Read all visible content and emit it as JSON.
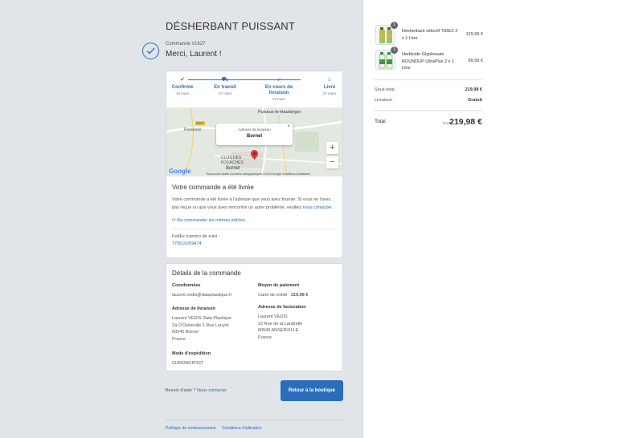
{
  "shop": {
    "title": "DÉSHERBANT PUISSANT"
  },
  "order": {
    "number": "Commande #1627",
    "thanks": "Merci, Laurent !"
  },
  "tracking": {
    "steps": [
      {
        "label": "Confirmé",
        "date": "19 mars",
        "icon": "check-icon"
      },
      {
        "label": "En transit",
        "date": "27 mars",
        "icon": "truck-icon"
      },
      {
        "label": "En cours de livraison",
        "date": "27 mars",
        "icon": "runner-icon"
      },
      {
        "label": "Livré",
        "date": "27 mars",
        "icon": "home-icon"
      }
    ]
  },
  "map": {
    "place1": "Puiseux-le-Hauberger",
    "place2": "Fosseuse",
    "place3": "CLOS DES FOUACHES",
    "place4": "Bornel",
    "road": "D927",
    "popup_title": "Adresse de livraison",
    "popup_value": "Bornel",
    "zoom_in": "+",
    "zoom_out": "−",
    "google": "Google",
    "attribution": "Raccourcis clavier   Données cartographiques ©2024 Google   Conditions d'utilisation"
  },
  "delivered": {
    "title": "Votre commande a été livrée",
    "text": "Votre commande a été livrée à l'adresse que vous avez fournie. Si vous ne l'avez pas reçue ou que vous avez rencontré un autre problème, veuillez ",
    "contact_link": "nous contacter",
    "text_end": ".",
    "reorder": "Re-commander les mêmes articles",
    "fedex_label": "FedEx numéro de suivi :",
    "fedex_number": "775610059474"
  },
  "details": {
    "title": "Détails de la commande",
    "contact_hd": "Coordonnées",
    "contact_val": "laurent.vedis@dataplastique.fr",
    "payment_hd": "Moyen de paiement",
    "payment_val": "Carte de crédit - ",
    "payment_amount": "219,98 €",
    "ship_hd": "Adresse de livraison",
    "ship_lines": [
      "Laurent VEDIS Data Plastique",
      "Za D'Outreville 1 Rue Louyot",
      "60540 Bornel",
      "France"
    ],
    "bill_hd": "Adresse de facturation",
    "bill_lines": [
      "Laurent VEDIS",
      "12 Rue de la Landrelle",
      "60540 ANSERVILLE",
      "France"
    ],
    "method_hd": "Mode d'expédition",
    "method_val": "CHRONOPOST"
  },
  "help": {
    "text": "Besoin d'aide ? ",
    "link": "Nous contacter"
  },
  "back_button": "Retour à la boutique",
  "footer": {
    "refund": "Politique de remboursement",
    "terms": "Conditions d'utilisation"
  },
  "cart": {
    "items": [
      {
        "name": "Désherbant sélectif TIDEX 2 x 1 Litre",
        "price": "129,99 €",
        "qty": "1"
      },
      {
        "name": "Herbicide Glyphosate ROUNDUP UltraPlus 2 x 1 Litre",
        "price": "89,99 €",
        "qty": "1"
      }
    ],
    "subtotal_label": "Sous-total",
    "subtotal": "219,98 €",
    "shipping_label": "Livraison",
    "shipping": "Gratuit",
    "total_label": "Total",
    "currency": "EUR",
    "total": "219,98 €"
  },
  "colors": {
    "accent": "#2a6ebb",
    "left_bg": "#e1e4e8"
  }
}
